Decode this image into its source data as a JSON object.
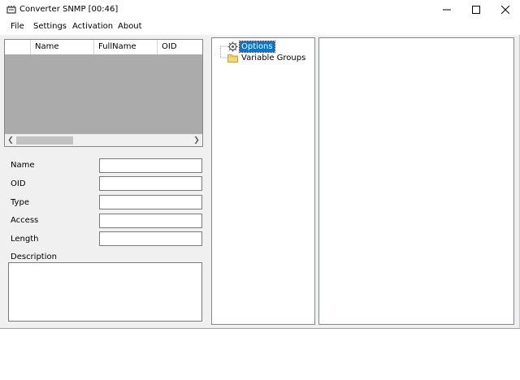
{
  "window": {
    "title": "Converter SNMP [00:46]",
    "controls": {
      "minimize": "minimize-icon",
      "maximize": "maximize-icon",
      "close": "close-icon"
    }
  },
  "menu": {
    "items": [
      "File",
      "Settings",
      "Activation",
      "About"
    ]
  },
  "grid": {
    "columns": [
      "",
      "Name",
      "FullName",
      "OID"
    ],
    "rows": []
  },
  "form": {
    "labels": {
      "name": "Name",
      "oid": "OID",
      "type": "Type",
      "access": "Access",
      "length": "Length",
      "description": "Description"
    },
    "values": {
      "name": "",
      "oid": "",
      "type": "",
      "access": "",
      "length": "",
      "description": ""
    }
  },
  "tree": {
    "items": [
      {
        "label": "Options",
        "icon": "gear-icon",
        "selected": true
      },
      {
        "label": "Variable Groups",
        "icon": "folder-icon",
        "selected": false
      }
    ]
  },
  "colors": {
    "selection": "#0078d7",
    "grid_body": "#ababab",
    "window_bg": "#f0f0f0"
  }
}
